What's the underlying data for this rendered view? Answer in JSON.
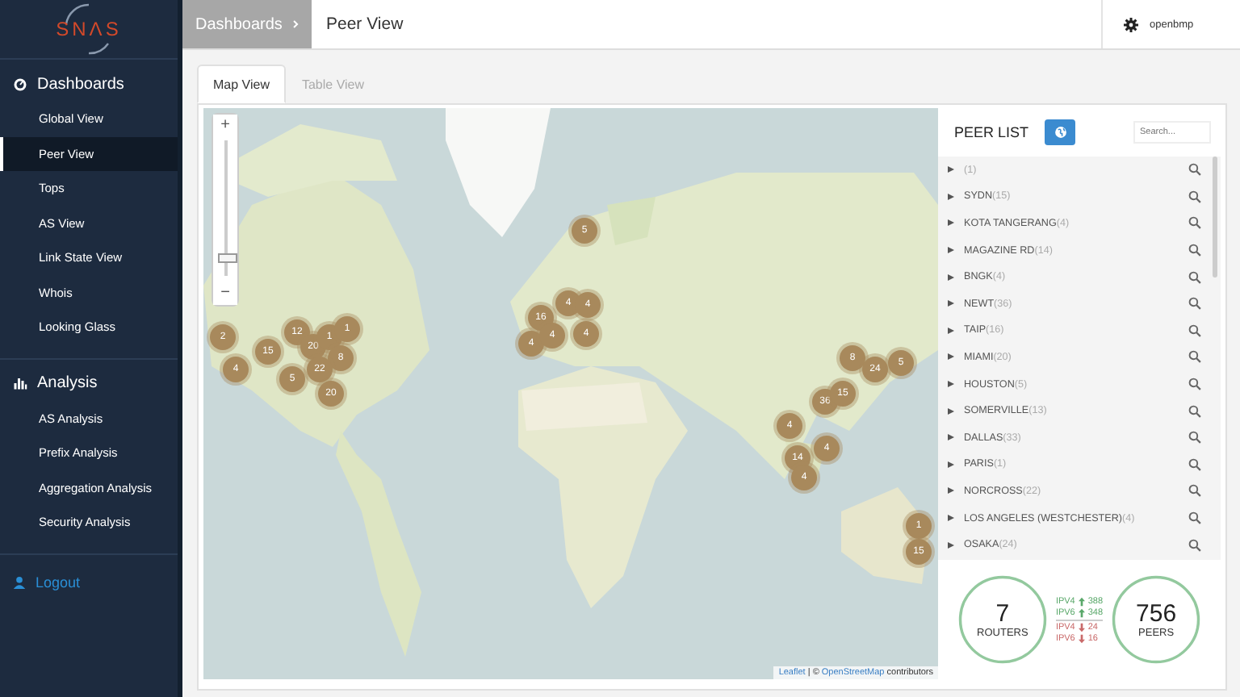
{
  "sidebar": {
    "logo": "SNΛS",
    "sections": [
      {
        "title": "Dashboards",
        "kind": "dashboard",
        "items": [
          {
            "label": "Global View",
            "selected": false
          },
          {
            "label": "Peer View",
            "selected": true
          },
          {
            "label": "Tops",
            "selected": false
          },
          {
            "label": "AS View",
            "selected": false
          },
          {
            "label": "Link State View",
            "selected": false
          },
          {
            "label": "Whois",
            "selected": false
          },
          {
            "label": "Looking Glass",
            "selected": false
          }
        ]
      },
      {
        "title": "Analysis",
        "kind": "chart",
        "items": [
          {
            "label": "AS Analysis",
            "selected": false
          },
          {
            "label": "Prefix Analysis",
            "selected": false
          },
          {
            "label": "Aggregation Analysis",
            "selected": false
          },
          {
            "label": "Security Analysis",
            "selected": false
          }
        ]
      }
    ],
    "logout": "Logout"
  },
  "header": {
    "breadcrumb": "Dashboards",
    "title": "Peer View",
    "user": "openbmp"
  },
  "tabs": [
    {
      "label": "Map View",
      "selected": true
    },
    {
      "label": "Table View",
      "selected": false
    }
  ],
  "map": {
    "zoom_in": "+",
    "zoom_out": "−",
    "markers": [
      "2",
      "4",
      "15",
      "12",
      "20",
      "1",
      "1",
      "8",
      "22",
      "5",
      "20",
      "5",
      "16",
      "4",
      "4",
      "4",
      "4",
      "4",
      "8",
      "24",
      "5",
      "36",
      "15",
      "4",
      "4",
      "14",
      "4",
      "1",
      "15"
    ],
    "attribution": {
      "link": "Leaflet",
      "middle": "| ©",
      "link2": "OpenStreetMap",
      "rest": "contributors"
    }
  },
  "peer_list": {
    "title": "PEER LIST",
    "search": {
      "placeholder": "Search..."
    },
    "rows": [
      {
        "count": "(1)"
      },
      {
        "name": "SYDN",
        "count": "(15)"
      },
      {
        "name": "KOTA TANGERANG",
        "count": "(4)"
      },
      {
        "name": "MAGAZINE RD",
        "count": "(14)"
      },
      {
        "name": "BNGK",
        "count": "(4)"
      },
      {
        "name": "NEWT",
        "count": "(36)"
      },
      {
        "name": "TAIP",
        "count": "(16)"
      },
      {
        "name": "MIAMI",
        "count": "(20)"
      },
      {
        "name": "HOUSTON",
        "count": "(5)"
      },
      {
        "name": "SOMERVILLE",
        "count": "(13)"
      },
      {
        "name": "DALLAS",
        "count": "(33)"
      },
      {
        "name": "PARIS",
        "count": "(1)"
      },
      {
        "name": "NORCROSS",
        "count": "(22)"
      },
      {
        "name": "LOS ANGELES (WESTCHESTER)",
        "count": "(4)"
      },
      {
        "name": "OSAKA",
        "count": "(24)"
      }
    ]
  },
  "summary": {
    "routers": {
      "value": "7",
      "label": "ROUTERS"
    },
    "changes": [
      {
        "label": "IPV4",
        "kind": "up",
        "value": "388"
      },
      {
        "label": "IPV6",
        "kind": "up",
        "value": "348"
      },
      {
        "label": "IPV4",
        "kind": "down",
        "value": "24"
      },
      {
        "label": "IPV6",
        "kind": "down",
        "value": "16"
      }
    ],
    "peers": {
      "value": "756",
      "label": "PEERS"
    }
  }
}
